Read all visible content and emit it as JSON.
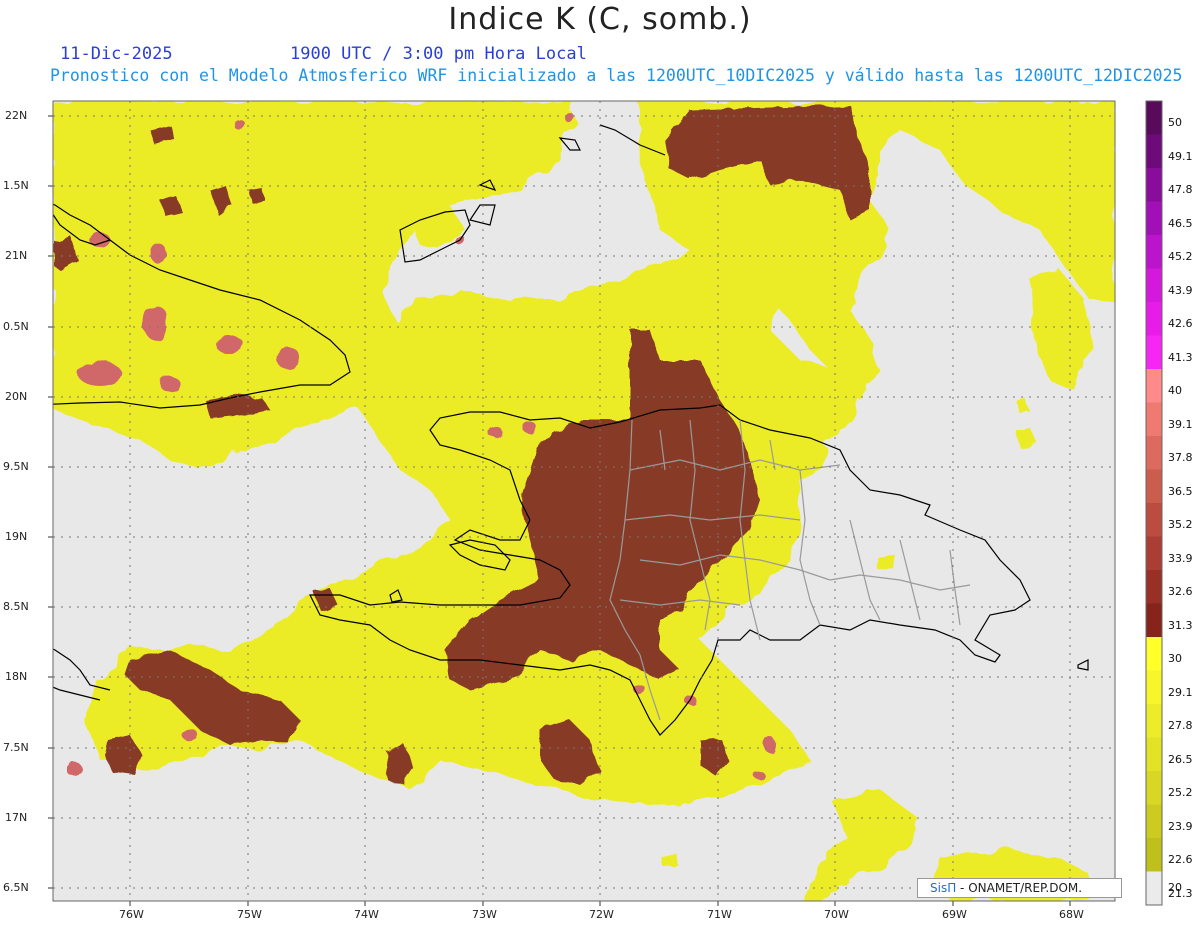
{
  "header": {
    "title": "Indice K (C, somb.)",
    "date": "11-Dic-2025",
    "time": "1900 UTC / 3:00 pm Hora Local",
    "run_info": "Pronostico con el Modelo Atmosferico WRF inicializado a las 1200UTC_10DIC2025 y válido hasta las  1200UTC_12DIC2025"
  },
  "axes": {
    "lat_labels": [
      "22N",
      "1.5N",
      "21N",
      "0.5N",
      "20N",
      "9.5N",
      "19N",
      "8.5N",
      "18N",
      "7.5N",
      "17N",
      "6.5N"
    ],
    "lon_labels": [
      "76W",
      "75W",
      "74W",
      "73W",
      "72W",
      "71W",
      "70W",
      "69W",
      "68W"
    ]
  },
  "colorbar": {
    "labels": [
      "50",
      "49.1",
      "47.8",
      "46.5",
      "45.2",
      "43.9",
      "42.6",
      "41.3",
      "40",
      "39.1",
      "37.8",
      "36.5",
      "35.2",
      "33.9",
      "32.6",
      "31.3",
      "30",
      "29.1",
      "27.8",
      "26.5",
      "25.2",
      "23.9",
      "22.6",
      "21.3",
      "20"
    ],
    "colors_top_to_bottom": [
      "#5a0a5a",
      "#6e0a7a",
      "#8a0c9a",
      "#a010b6",
      "#bb14cc",
      "#d418dc",
      "#e81ce8",
      "#f826f4",
      "#ff8a8a",
      "#ee7a72",
      "#dd6a5e",
      "#cc5c4e",
      "#bc4c40",
      "#aa3e34",
      "#983028",
      "#86241c",
      "#ffff2a",
      "#f6f62a",
      "#ecec28",
      "#e2e226",
      "#d8d824",
      "#cccc20",
      "#c0c01c",
      "#ebebeb"
    ]
  },
  "legend_colors": {
    "background": "#e8e8e8",
    "yellow": "#ecec26",
    "brown": "#873a26",
    "pink": "#d0686a",
    "coast": "#000000",
    "provinces": "#9a9a9a"
  },
  "credit": {
    "brand": "SisΠ",
    "org": " - ONAMET/REP.DOM."
  }
}
